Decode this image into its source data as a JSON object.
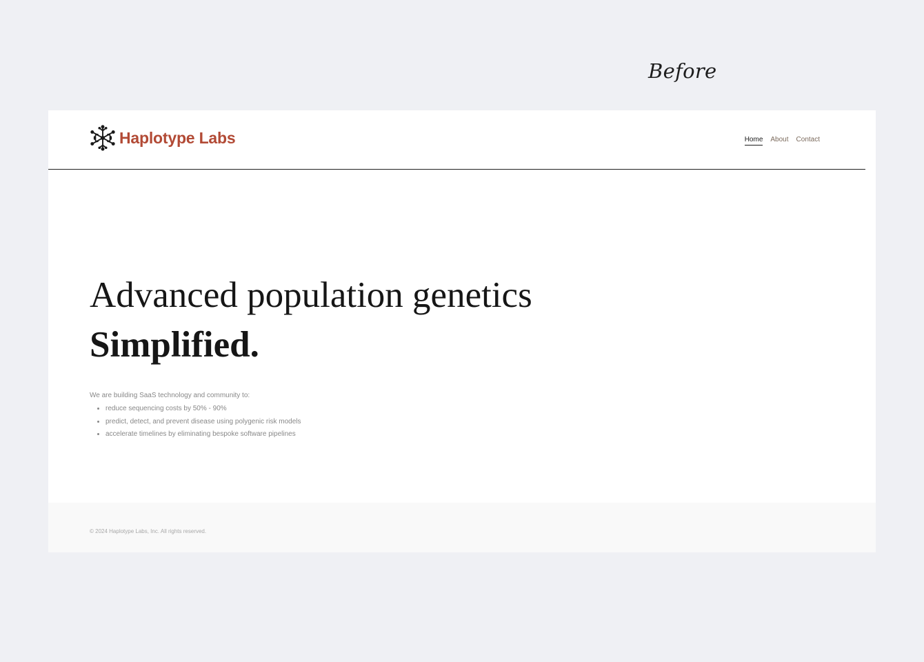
{
  "annotation": {
    "label": "Before"
  },
  "header": {
    "brand_name": "Haplotype Labs",
    "logo_icon": "molecule-snowflake-icon",
    "nav": [
      {
        "label": "Home",
        "active": true
      },
      {
        "label": "About",
        "active": false
      },
      {
        "label": "Contact",
        "active": false
      }
    ]
  },
  "hero": {
    "line1": "Advanced population genetics",
    "line2": "Simplified."
  },
  "intro": {
    "lead": "We are building SaaS technology and community to:",
    "points": [
      "reduce sequencing costs by 50% - 90%",
      "predict, detect, and prevent disease using polygenic risk models",
      "accelerate timelines by eliminating bespoke software pipelines"
    ]
  },
  "footer": {
    "copyright": "© 2024 Haplotype Labs, Inc. All rights reserved."
  },
  "colors": {
    "brand": "#b24a35",
    "backdrop": "#eff0f4",
    "text_dark": "#161616",
    "text_muted": "#888888",
    "footer_bg": "#f9f9f9"
  }
}
